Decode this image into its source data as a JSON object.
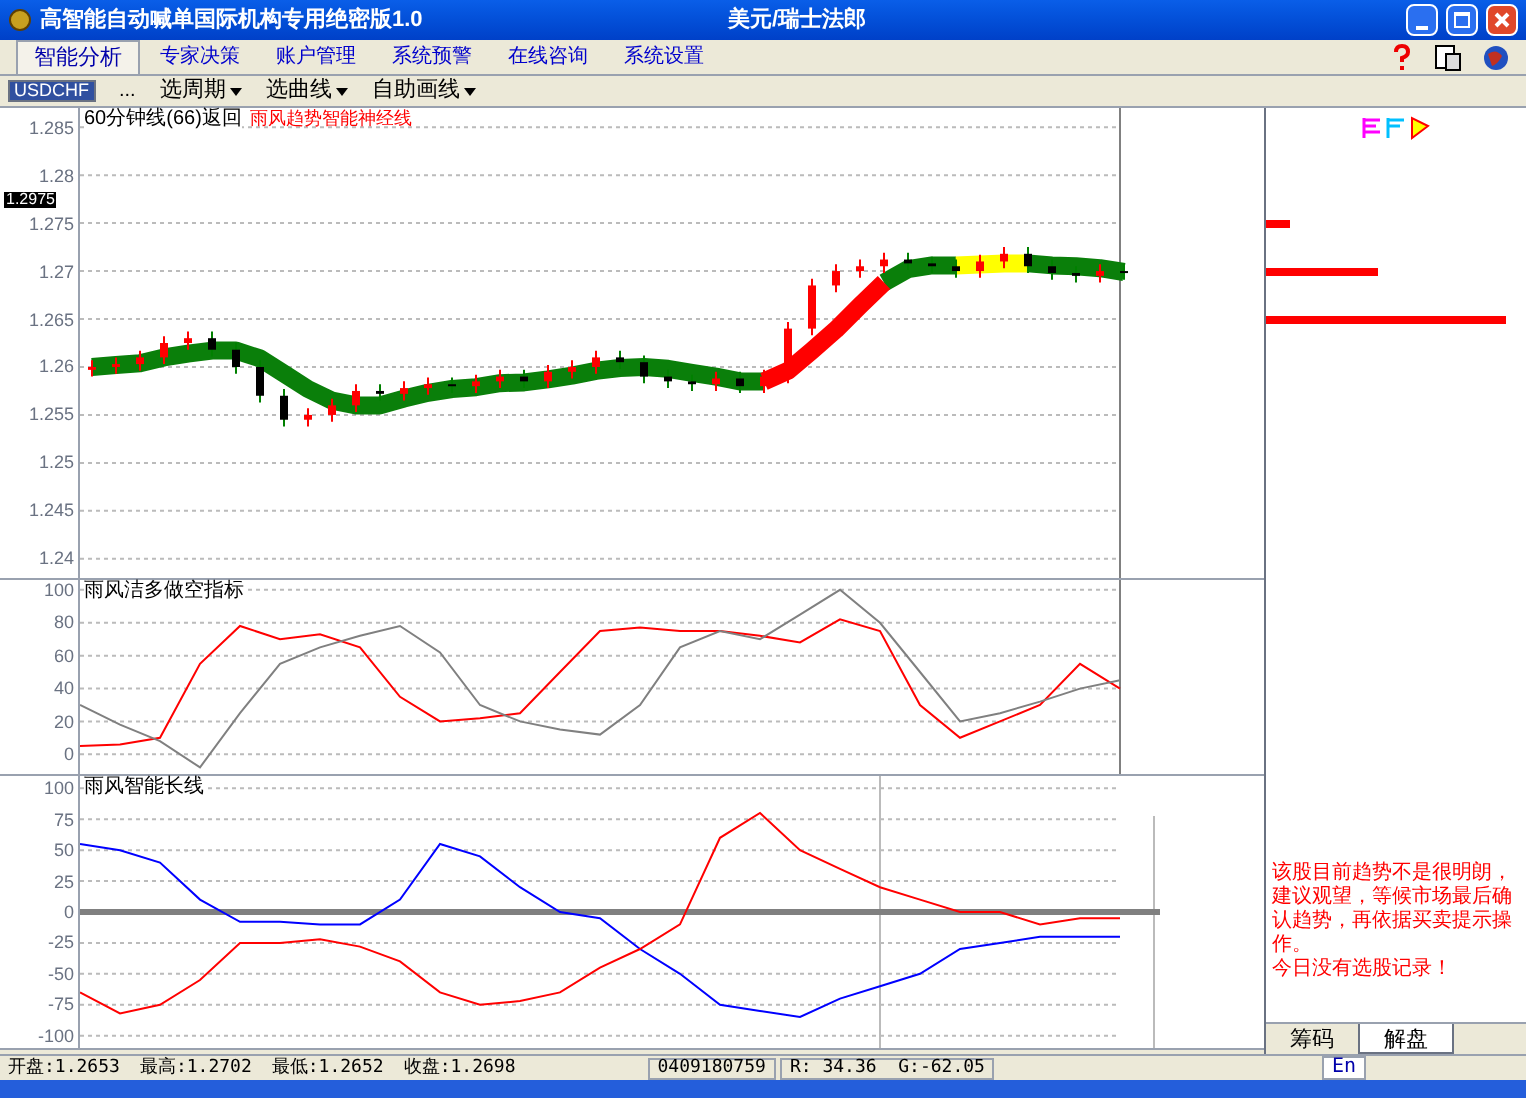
{
  "window": {
    "title": "高智能自动喊单国际机构专用绝密版1.0",
    "symbol_name": "美元/瑞士法郎"
  },
  "tabs": [
    {
      "label": "智能分析",
      "selected": true
    },
    {
      "label": "专家决策",
      "selected": false
    },
    {
      "label": "账户管理",
      "selected": false
    },
    {
      "label": "系统预警",
      "selected": false
    },
    {
      "label": "在线咨询",
      "selected": false
    },
    {
      "label": "系统设置",
      "selected": false
    }
  ],
  "toolbar": {
    "symbol": "USDCHF",
    "more": "...",
    "menus": [
      "选周期",
      "选曲线",
      "自助画线"
    ]
  },
  "price_pane": {
    "title": "60分钟线(66)返回",
    "indicator": "雨风趋势智能神经线",
    "current_price": "1.2975",
    "chart_data": {
      "type": "candlestick",
      "grid": true,
      "yticks": [
        1.285,
        1.28,
        1.275,
        1.27,
        1.265,
        1.26,
        1.255,
        1.25,
        1.245,
        1.24
      ],
      "ylim": [
        1.238,
        1.287
      ],
      "ohlc": [
        [
          1.2597,
          1.2607,
          1.259,
          1.26
        ],
        [
          1.26,
          1.261,
          1.2593,
          1.2603
        ],
        [
          1.2603,
          1.2617,
          1.2596,
          1.261
        ],
        [
          1.261,
          1.2632,
          1.2603,
          1.2625
        ],
        [
          1.2625,
          1.2637,
          1.2618,
          1.263
        ],
        [
          1.263,
          1.2637,
          1.2611,
          1.2618
        ],
        [
          1.2618,
          1.2625,
          1.2593,
          1.26
        ],
        [
          1.26,
          1.2607,
          1.2563,
          1.257
        ],
        [
          1.257,
          1.2577,
          1.2538,
          1.2545
        ],
        [
          1.2545,
          1.2557,
          1.2538,
          1.255
        ],
        [
          1.255,
          1.2567,
          1.2543,
          1.256
        ],
        [
          1.256,
          1.2582,
          1.2553,
          1.2575
        ],
        [
          1.2575,
          1.2582,
          1.2565,
          1.2572
        ],
        [
          1.2572,
          1.2585,
          1.2565,
          1.2578
        ],
        [
          1.2578,
          1.2589,
          1.2571,
          1.2582
        ],
        [
          1.2582,
          1.2589,
          1.2573,
          1.258
        ],
        [
          1.258,
          1.2592,
          1.2573,
          1.2585
        ],
        [
          1.2585,
          1.2597,
          1.2578,
          1.259
        ],
        [
          1.259,
          1.2597,
          1.2578,
          1.2585
        ],
        [
          1.2585,
          1.2602,
          1.2578,
          1.2595
        ],
        [
          1.2595,
          1.2607,
          1.2588,
          1.26
        ],
        [
          1.26,
          1.2617,
          1.2593,
          1.261
        ],
        [
          1.261,
          1.2617,
          1.2598,
          1.2605
        ],
        [
          1.2605,
          1.2612,
          1.2583,
          1.259
        ],
        [
          1.259,
          1.2597,
          1.2578,
          1.2585
        ],
        [
          1.2585,
          1.2592,
          1.2575,
          1.2582
        ],
        [
          1.2582,
          1.2595,
          1.2575,
          1.2588
        ],
        [
          1.2588,
          1.2595,
          1.2573,
          1.258
        ],
        [
          1.258,
          1.2597,
          1.2573,
          1.259
        ],
        [
          1.259,
          1.2647,
          1.2583,
          1.264
        ],
        [
          1.264,
          1.2692,
          1.2633,
          1.2685
        ],
        [
          1.2685,
          1.2707,
          1.2678,
          1.27
        ],
        [
          1.27,
          1.2712,
          1.2693,
          1.2705
        ],
        [
          1.2705,
          1.2719,
          1.2698,
          1.2712
        ],
        [
          1.2712,
          1.2719,
          1.2701,
          1.2708
        ],
        [
          1.2708,
          1.2715,
          1.2698,
          1.2705
        ],
        [
          1.2705,
          1.2712,
          1.2693,
          1.27
        ],
        [
          1.27,
          1.2717,
          1.2693,
          1.271
        ],
        [
          1.271,
          1.2725,
          1.2703,
          1.2718
        ],
        [
          1.2718,
          1.2725,
          1.2698,
          1.2705
        ],
        [
          1.2705,
          1.2712,
          1.2691,
          1.2698
        ],
        [
          1.2698,
          1.2705,
          1.2688,
          1.2695
        ],
        [
          1.2695,
          1.2707,
          1.2688,
          1.27
        ],
        [
          1.27,
          1.2707,
          1.2691,
          1.2698
        ]
      ],
      "series": [
        {
          "type": "line",
          "color": "#0a7f0a",
          "values": [
            1.26,
            1.2602,
            1.2604,
            1.261,
            1.2614,
            1.2617,
            1.2617,
            1.2609,
            1.2593,
            1.2577,
            1.2565,
            1.256,
            1.256,
            1.2567,
            1.2573,
            1.2577,
            1.2579,
            1.2583,
            1.2584,
            1.2587,
            1.2591,
            1.2596,
            1.2599,
            1.26,
            1.2598,
            1.2594,
            1.259,
            1.2585,
            1.2585,
            null,
            null,
            null,
            null,
            1.2688,
            1.2702,
            1.2706,
            1.2706,
            null,
            null,
            1.2708,
            1.2706,
            1.2705,
            1.2703,
            1.2699
          ]
        },
        {
          "type": "line",
          "color": "#ff0000",
          "values": [
            null,
            null,
            null,
            null,
            null,
            null,
            null,
            null,
            null,
            null,
            null,
            null,
            null,
            null,
            null,
            null,
            null,
            null,
            null,
            null,
            null,
            null,
            null,
            null,
            null,
            null,
            null,
            null,
            1.2585,
            1.2596,
            1.2617,
            1.2639,
            1.2664,
            1.2688,
            null,
            null,
            null,
            null,
            null,
            null,
            null,
            null,
            null,
            null
          ]
        },
        {
          "type": "line",
          "color": "#ffff00",
          "values": [
            null,
            null,
            null,
            null,
            null,
            null,
            null,
            null,
            null,
            null,
            null,
            null,
            null,
            null,
            null,
            null,
            null,
            null,
            null,
            null,
            null,
            null,
            null,
            null,
            null,
            null,
            null,
            null,
            null,
            null,
            null,
            null,
            null,
            null,
            null,
            null,
            1.2706,
            1.2707,
            1.2708,
            1.2708,
            null,
            null,
            null,
            null
          ]
        }
      ]
    }
  },
  "pane_1": {
    "title": "雨风洁多做空指标",
    "chart_data": {
      "type": "line",
      "grid": true,
      "yticks": [
        100,
        80,
        60,
        40,
        20,
        0
      ],
      "ylim": [
        -12,
        106
      ],
      "series": [
        {
          "color": "#ff0000",
          "values": [
            5,
            6,
            10,
            55,
            78,
            70,
            73,
            65,
            35,
            20,
            22,
            25,
            50,
            75,
            77,
            75,
            75,
            72,
            68,
            82,
            75,
            30,
            10,
            20,
            30,
            55,
            40
          ]
        },
        {
          "color": "#808080",
          "values": [
            30,
            18,
            8,
            -8,
            25,
            55,
            65,
            72,
            78,
            62,
            30,
            20,
            15,
            12,
            30,
            65,
            75,
            70,
            85,
            100,
            80,
            50,
            20,
            25,
            32,
            40,
            45
          ]
        }
      ]
    }
  },
  "pane_2": {
    "title": "雨风智能长线",
    "chart_data": {
      "type": "line",
      "grid": true,
      "yticks": [
        100,
        75,
        50,
        25,
        0,
        -25,
        -50,
        -75,
        -100
      ],
      "ylim": [
        -110,
        110
      ],
      "series": [
        {
          "color": "#0000ff",
          "values": [
            55,
            50,
            40,
            10,
            -8,
            -8,
            -10,
            -10,
            10,
            55,
            45,
            20,
            0,
            -5,
            -30,
            -50,
            -75,
            -80,
            -85,
            -70,
            -60,
            -50,
            -30,
            -25,
            -20,
            -20,
            -20
          ]
        },
        {
          "color": "#ff0000",
          "values": [
            -65,
            -82,
            -75,
            -55,
            -25,
            -25,
            -22,
            -28,
            -40,
            -65,
            -75,
            -72,
            -65,
            -45,
            -30,
            -10,
            60,
            80,
            50,
            35,
            20,
            10,
            0,
            0,
            -10,
            -5,
            -5
          ]
        }
      ]
    }
  },
  "side_panel": {
    "advice": "该股目前趋势不是很明朗，建议观望，等候市场最后确认趋势，再依据买卖提示操作。",
    "note": "今日没有选股记录！",
    "tabs": [
      {
        "label": "筹码",
        "selected": false
      },
      {
        "label": "解盘",
        "selected": true
      }
    ]
  },
  "status_bar": [
    "开盘:1.2653",
    "最高:1.2702",
    "最低:1.2652",
    "收盘:1.2698",
    "0409180759",
    "R: 34.36  G:-62.05"
  ],
  "language_bar": {
    "label": "En"
  }
}
